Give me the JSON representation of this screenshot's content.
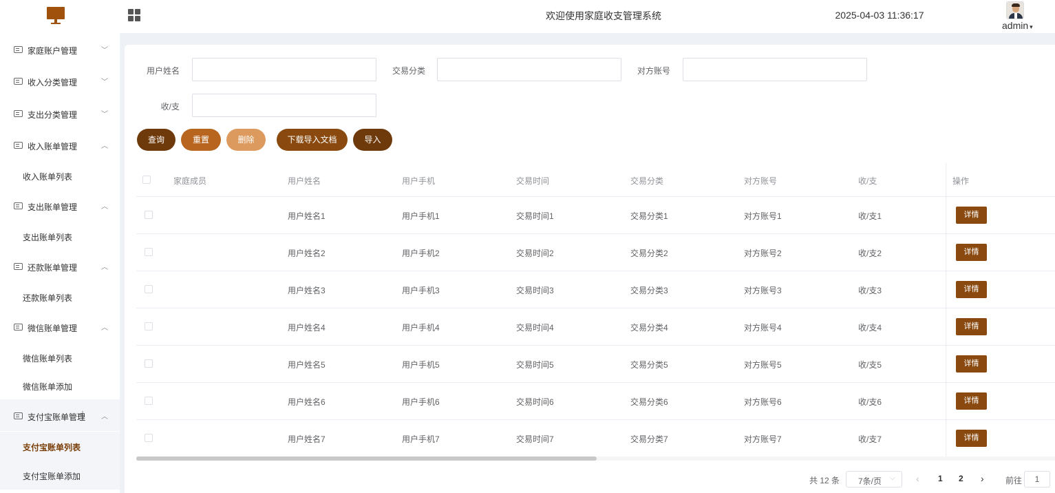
{
  "header": {
    "title": "欢迎使用家庭收支管理系统",
    "datetime": "2025-04-03 11:36:17",
    "username": "admin",
    "caret": "▾"
  },
  "sidebar": {
    "items": [
      {
        "label": "家庭账户管理",
        "arrow": "﹀"
      },
      {
        "label": "收入分类管理",
        "arrow": "﹀"
      },
      {
        "label": "支出分类管理",
        "arrow": "﹀"
      },
      {
        "label": "收入账单管理",
        "arrow": "︿",
        "sub": [
          "收入账单列表"
        ]
      },
      {
        "label": "支出账单管理",
        "arrow": "︿",
        "sub": [
          "支出账单列表"
        ]
      },
      {
        "label": "还款账单管理",
        "arrow": "︿",
        "sub": [
          "还款账单列表"
        ]
      },
      {
        "label": "微信账单管理",
        "arrow": "︿",
        "sub": [
          "微信账单列表",
          "微信账单添加"
        ]
      },
      {
        "label": "支付宝账单管理",
        "arrow": "︿",
        "sub": [
          "支付宝账单列表",
          "支付宝账单添加"
        ]
      }
    ],
    "active_item": "支付宝账单列表"
  },
  "search": {
    "username_label": "用户姓名",
    "username_value": "",
    "category_label": "交易分类",
    "category_value": "",
    "account_label": "对方账号",
    "account_value": "",
    "type_label": "收/支",
    "type_value": ""
  },
  "toolbar": {
    "query": "查询",
    "reset": "重置",
    "delete": "删除",
    "download": "下载导入文档",
    "import": "导入"
  },
  "table": {
    "columns": [
      "家庭成员",
      "用户姓名",
      "用户手机",
      "交易时间",
      "交易分类",
      "对方账号",
      "收/支",
      "操作"
    ],
    "rows": [
      [
        "",
        "用户姓名1",
        "用户手机1",
        "交易时间1",
        "交易分类1",
        "对方账号1",
        "收/支1"
      ],
      [
        "",
        "用户姓名2",
        "用户手机2",
        "交易时间2",
        "交易分类2",
        "对方账号2",
        "收/支2"
      ],
      [
        "",
        "用户姓名3",
        "用户手机3",
        "交易时间3",
        "交易分类3",
        "对方账号3",
        "收/支3"
      ],
      [
        "",
        "用户姓名4",
        "用户手机4",
        "交易时间4",
        "交易分类4",
        "对方账号4",
        "收/支4"
      ],
      [
        "",
        "用户姓名5",
        "用户手机5",
        "交易时间5",
        "交易分类5",
        "对方账号5",
        "收/支5"
      ],
      [
        "",
        "用户姓名6",
        "用户手机6",
        "交易时间6",
        "交易分类6",
        "对方账号6",
        "收/支6"
      ],
      [
        "",
        "用户姓名7",
        "用户手机7",
        "交易时间7",
        "交易分类7",
        "对方账号7",
        "收/支7"
      ]
    ],
    "detail_label": "详情"
  },
  "pagination": {
    "total": "共 12 条",
    "page_size": "7条/页",
    "pages": [
      "1",
      "2"
    ],
    "current_page": "1",
    "goto_label": "前往",
    "goto_value": "1",
    "prev": "‹",
    "next": "›",
    "size_caret": "⌵"
  },
  "colors": {
    "primary": "#6e3a0c",
    "accent": "#b8661f",
    "light": "#dc9a5e",
    "detail": "#8a4a0f"
  }
}
